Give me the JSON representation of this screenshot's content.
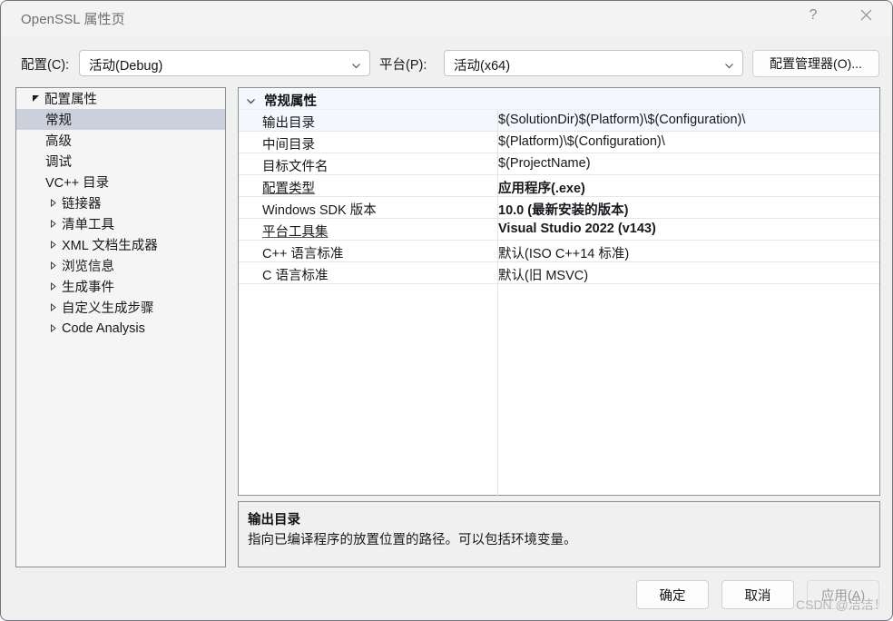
{
  "window": {
    "title": "OpenSSL 属性页",
    "help_icon": "question-mark-icon",
    "close_icon": "close-icon"
  },
  "toolbar": {
    "config_label": "配置(C):",
    "config_value": "活动(Debug)",
    "platform_label": "平台(P):",
    "platform_value": "活动(x64)",
    "config_manager_label": "配置管理器(O)...",
    "chevron_icon": "chevron-down-icon"
  },
  "tree": {
    "items": [
      {
        "label": "配置属性",
        "level": 0,
        "twisty": "expanded",
        "selected": false
      },
      {
        "label": "常规",
        "level": 1,
        "twisty": "none",
        "selected": true
      },
      {
        "label": "高级",
        "level": 1,
        "twisty": "none",
        "selected": false
      },
      {
        "label": "调试",
        "level": 1,
        "twisty": "none",
        "selected": false
      },
      {
        "label": "VC++ 目录",
        "level": 1,
        "twisty": "none",
        "selected": false
      },
      {
        "label": "链接器",
        "level": 1,
        "twisty": "collapsed",
        "selected": false
      },
      {
        "label": "清单工具",
        "level": 1,
        "twisty": "collapsed",
        "selected": false
      },
      {
        "label": "XML 文档生成器",
        "level": 1,
        "twisty": "collapsed",
        "selected": false
      },
      {
        "label": "浏览信息",
        "level": 1,
        "twisty": "collapsed",
        "selected": false
      },
      {
        "label": "生成事件",
        "level": 1,
        "twisty": "collapsed",
        "selected": false
      },
      {
        "label": "自定义生成步骤",
        "level": 1,
        "twisty": "collapsed",
        "selected": false
      },
      {
        "label": "Code Analysis",
        "level": 1,
        "twisty": "collapsed",
        "selected": false
      }
    ]
  },
  "grid": {
    "group_label": "常规属性",
    "group_chevron": "chevron-down-icon",
    "rows": [
      {
        "name": "输出目录",
        "value": "$(SolutionDir)$(Platform)\\$(Configuration)\\",
        "bold": false,
        "underline": false,
        "selected": true
      },
      {
        "name": "中间目录",
        "value": "$(Platform)\\$(Configuration)\\",
        "bold": false,
        "underline": false,
        "selected": false
      },
      {
        "name": "目标文件名",
        "value": "$(ProjectName)",
        "bold": false,
        "underline": false,
        "selected": false
      },
      {
        "name": "配置类型",
        "value": "应用程序(.exe)",
        "bold": true,
        "underline": true,
        "selected": false
      },
      {
        "name": "Windows SDK 版本",
        "value": "10.0 (最新安装的版本)",
        "bold": true,
        "underline": false,
        "selected": false
      },
      {
        "name": "平台工具集",
        "value": "Visual Studio 2022 (v143)",
        "bold": true,
        "underline": true,
        "selected": false
      },
      {
        "name": "C++ 语言标准",
        "value": "默认(ISO C++14 标准)",
        "bold": false,
        "underline": false,
        "selected": false
      },
      {
        "name": "C 语言标准",
        "value": "默认(旧 MSVC)",
        "bold": false,
        "underline": false,
        "selected": false
      }
    ]
  },
  "description": {
    "title": "输出目录",
    "body": "指向已编译程序的放置位置的路径。可以包括环境变量。"
  },
  "footer": {
    "ok_label": "确定",
    "cancel_label": "取消",
    "apply_label": "应用(A)"
  },
  "watermark": {
    "text": "CSDN @洁洁！"
  },
  "colors": {
    "dialog_bg": "#f0f0f0",
    "titlebar_bg": "#f3f3f3",
    "panel_border": "#8d8f96",
    "tree_selected": "#cbd0dc",
    "grid_group_bg": "#f4f7fb",
    "desc_bg": "#f0f0f0",
    "disabled_text": "#9a9a9a"
  }
}
